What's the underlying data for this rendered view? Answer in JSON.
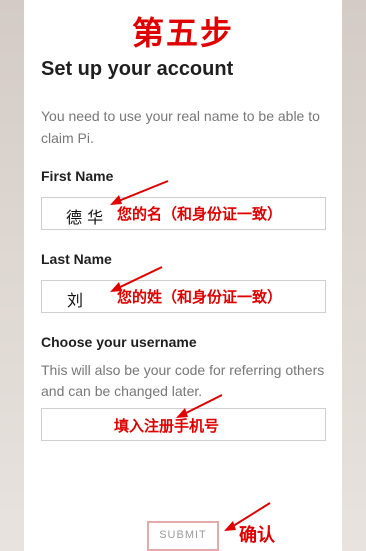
{
  "overlay": {
    "step_title": "第五步",
    "first_name_note": "您的名（和身份证一致）",
    "last_name_note": "您的姓（和身份证一致）",
    "username_note": "填入注册手机号",
    "submit_note": "确认"
  },
  "form": {
    "title": "Set up your account",
    "intro": "You need to use your real name to be able to claim Pi.",
    "first_name_label": "First Name",
    "first_name_value": "德 华",
    "last_name_label": "Last Name",
    "last_name_value": "刘",
    "username_label": "Choose your username",
    "username_helper": "This will also be your code for referring others and can be changed later.",
    "submit_label": "SUBMIT"
  },
  "colors": {
    "annotation": "#e00000",
    "submit_border": "#e4a9a9"
  }
}
